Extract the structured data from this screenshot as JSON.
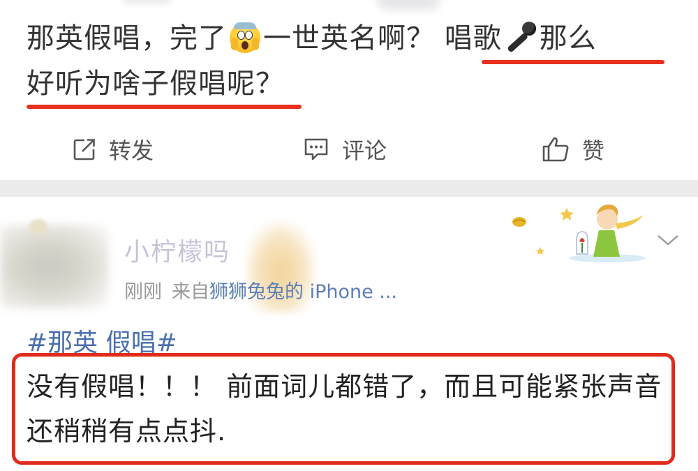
{
  "post": {
    "line1_before_emoji": "那英假唱，完了",
    "line1_after_emoji": "一世英名啊？",
    "line1_underlined_a": "唱歌",
    "line1_underlined_b": "那么",
    "line2": "好听为啥子假唱呢？",
    "emoji_icon": "scream-emoji-icon",
    "mic_icon": "microphone-icon"
  },
  "actions": {
    "forward": "转发",
    "comment": "评论",
    "like": "赞"
  },
  "comment_post": {
    "user_name": "小柠檬吗",
    "time": "刚刚",
    "source_prefix": "来自",
    "source": "狮狮兔兔的 iPhone ...",
    "topic": "#那英 假唱#",
    "body": "没有假唱！！！ 前面词儿都错了，而且可能紧张声音还稍稍有点点抖."
  },
  "colors": {
    "highlight_red": "#e8301c",
    "link_blue": "#4a6fae",
    "divider": "#ececec"
  }
}
